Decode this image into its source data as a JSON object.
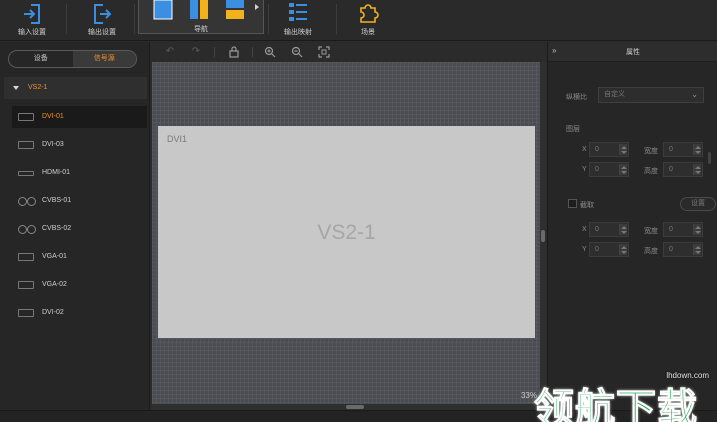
{
  "toolbar": {
    "input_settings": "输入设置",
    "output_settings": "输出设置",
    "layout": "导航",
    "output_mapping": "输出映射",
    "scene": "场景"
  },
  "left_panel": {
    "tabs": [
      {
        "label": "设备",
        "active": false
      },
      {
        "label": "信号源",
        "active": true
      }
    ],
    "group": "VS2-1",
    "sources": [
      {
        "name": "DVI-01",
        "port": "dvi",
        "active": true
      },
      {
        "name": "DVI-03",
        "port": "dvi",
        "active": false
      },
      {
        "name": "HDMI-01",
        "port": "hdmi",
        "active": false
      },
      {
        "name": "CVBS-01",
        "port": "cvbs",
        "active": false
      },
      {
        "name": "CVBS-02",
        "port": "cvbs",
        "active": false
      },
      {
        "name": "VGA-01",
        "port": "vga",
        "active": false
      },
      {
        "name": "VGA-02",
        "port": "vga",
        "active": false
      },
      {
        "name": "DVI-02",
        "port": "dvi",
        "active": false
      }
    ]
  },
  "canvas": {
    "screen_label": "DVI1",
    "screen_name": "VS2-1",
    "zoom": "33%"
  },
  "properties": {
    "title": "属性",
    "ratio_label": "纵横比",
    "ratio_value": "自定义",
    "layer_section": "图层",
    "x_label": "X",
    "y_label": "Y",
    "width_label": "宽度",
    "height_label": "高度",
    "x_value": "0",
    "y_value": "0",
    "width_value": "0",
    "height_value": "0",
    "crop_label": "截取",
    "crop_button": "设置",
    "crop_x_value": "0",
    "crop_y_value": "0",
    "crop_width_value": "0",
    "crop_height_value": "0"
  },
  "watermark": {
    "url": "lhdown.com",
    "text": "领航下载"
  },
  "colors": {
    "accent": "#f0922b",
    "toolbar_icon": "#3a8fe0",
    "layout_yellow": "#f2b21c",
    "watermark_green": "#1aa84c"
  }
}
